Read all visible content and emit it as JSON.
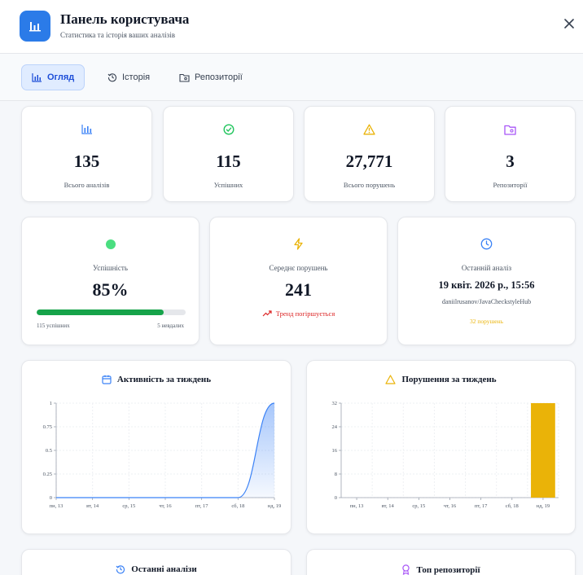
{
  "header": {
    "title": "Панель користувача",
    "subtitle": "Статистика та історія ваших аналізів"
  },
  "tabs": [
    {
      "label": "Огляд",
      "active": true
    },
    {
      "label": "Історія",
      "active": false
    },
    {
      "label": "Репозиторії",
      "active": false
    }
  ],
  "stats": [
    {
      "value": "135",
      "label": "Всього аналізів",
      "icon": "bar-chart-icon",
      "color": "#3b82f6"
    },
    {
      "value": "115",
      "label": "Успішних",
      "icon": "check-circle-icon",
      "color": "#22c55e"
    },
    {
      "value": "27,771",
      "label": "Всього порушень",
      "icon": "warning-icon",
      "color": "#eab308"
    },
    {
      "value": "3",
      "label": "Репозиторії",
      "icon": "folder-icon",
      "color": "#a855f7"
    }
  ],
  "success_card": {
    "label": "Успішність",
    "value": "85%",
    "progress": 0.85,
    "left_caption": "115 успішних",
    "right_caption": "5 невдалих",
    "color": "#16a34a"
  },
  "avg_card": {
    "label": "Середнє порушень",
    "value": "241",
    "trend": "Тренд погіршується",
    "trend_color": "#dc2626"
  },
  "last_card": {
    "label": "Останній аналіз",
    "date": "19 квіт. 2026 р., 15:56",
    "repo": "daniilrusanov/JavaCheckstyleHub",
    "violations": "32 порушень",
    "violations_color": "#eab308"
  },
  "chart_data": [
    {
      "type": "area",
      "title": "Активність за тиждень",
      "categories": [
        "пн, 13",
        "вт, 14",
        "ср, 15",
        "чт, 16",
        "пт, 17",
        "сб, 18",
        "нд, 19"
      ],
      "values": [
        0,
        0,
        0,
        0,
        0,
        0,
        1
      ],
      "yticks": [
        "0",
        "0.25",
        "0.5",
        "0.75",
        "1"
      ],
      "ylim": [
        0,
        1
      ],
      "grid": true,
      "color": "#3b82f6"
    },
    {
      "type": "bar",
      "title": "Порушення за тиждень",
      "categories": [
        "пн, 13",
        "вт, 14",
        "ср, 15",
        "чт, 16",
        "пт, 17",
        "сб, 18",
        "нд, 19"
      ],
      "values": [
        0,
        0,
        0,
        0,
        0,
        0,
        32
      ],
      "yticks": [
        "0",
        "8",
        "16",
        "24",
        "32"
      ],
      "ylim": [
        0,
        32
      ],
      "grid": true,
      "color": "#eab308"
    }
  ],
  "bottom_panels": [
    {
      "title": "Останні аналізи"
    },
    {
      "title": "Топ репозиторії"
    }
  ]
}
